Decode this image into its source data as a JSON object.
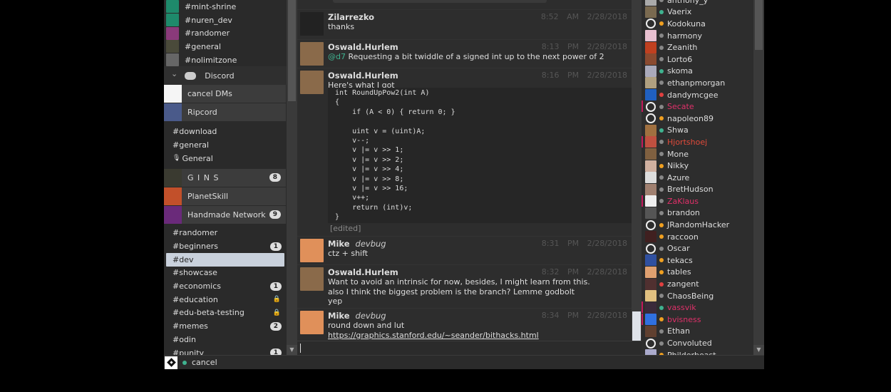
{
  "sidebar": {
    "top_channels": [
      {
        "label": "#mint-shrine",
        "color": "#1e8a6b"
      },
      {
        "label": "#nuren_dev",
        "color": "#1e8a6b"
      },
      {
        "label": "#randomer",
        "color": "#8a3a7a"
      },
      {
        "label": "#general",
        "color": "#4a4a3a"
      },
      {
        "label": "#nolimitzone",
        "color": "#666666"
      }
    ],
    "discord_header": "Discord",
    "servers_a": [
      {
        "label": "cancel DMs"
      },
      {
        "label": "Ripcord"
      }
    ],
    "ripcord_channels": [
      {
        "label": "#download"
      },
      {
        "label": "#general"
      },
      {
        "label": "General",
        "voice": true
      }
    ],
    "servers_b": [
      {
        "label": "G I N S",
        "badge": "8"
      },
      {
        "label": "PlanetSkill"
      },
      {
        "label": "Handmade Network",
        "badge": "9"
      }
    ],
    "hmn_channels": [
      {
        "label": "#randomer"
      },
      {
        "label": "#beginners",
        "badge": "1"
      },
      {
        "label": "#dev",
        "selected": true
      },
      {
        "label": "#showcase"
      },
      {
        "label": "#economics",
        "badge": "1"
      },
      {
        "label": "#education",
        "locked": true
      },
      {
        "label": "#edu-beta-testing",
        "locked": true
      },
      {
        "label": "#memes",
        "badge": "2"
      },
      {
        "label": "#odin"
      },
      {
        "label": "#punity",
        "badge": "1"
      }
    ]
  },
  "messages": [
    {
      "author": "Zilarrezko",
      "time": "8:52 AM",
      "date": "2/28/2018",
      "lines": [
        "thanks"
      ]
    },
    {
      "author": "Oswald.Hurlem",
      "time": "8:13 PM",
      "date": "2/28/2018",
      "mention": "@d7",
      "lines": [
        "Requesting a bit twiddle of a signed int up to the next power of 2"
      ]
    },
    {
      "author": "Oswald.Hurlem",
      "time": "8:16 PM",
      "date": "2/28/2018",
      "lines": [
        "Here's what I got"
      ],
      "code": " int RoundUpPow2(int A)\n {\n     if (A < 0) { return 0; }\n\n     uint v = (uint)A;\n     v--;\n     v |= v >> 1;\n     v |= v >> 2;\n     v |= v >> 4;\n     v |= v >> 8;\n     v |= v >> 16;\n     v++;\n     return (int)v;\n }",
      "edited": "[edited]"
    },
    {
      "author": "Mike",
      "role": "devbug",
      "time": "8:31 PM",
      "date": "2/28/2018",
      "lines": [
        "ctz + shift"
      ]
    },
    {
      "author": "Oswald.Hurlem",
      "time": "8:32 PM",
      "date": "2/28/2018",
      "lines": [
        "Want to avoid an intrinsic for now, besides, I might learn from this.\nalso I think the biggest problem is the branch? Lemme godbolt\nyep"
      ]
    },
    {
      "author": "Mike",
      "role": "devbug",
      "time": "8:34 PM",
      "date": "2/28/2018",
      "lines": [
        "round down and lut"
      ],
      "link": "https://graphics.stanford.edu/~seander/bithacks.html"
    }
  ],
  "input": {
    "value": ""
  },
  "members": [
    {
      "name": "anthony_y",
      "status": "#888888"
    },
    {
      "name": "Vaerix",
      "status": "#3fb28f"
    },
    {
      "name": "Kodokuna",
      "status": "#f0a020",
      "ring": true
    },
    {
      "name": "harmony",
      "status": "#888888"
    },
    {
      "name": "Zeanith",
      "status": "#888888"
    },
    {
      "name": "Lorto6",
      "status": "#888888"
    },
    {
      "name": "skoma",
      "status": "#3fb28f"
    },
    {
      "name": "ethanpmorgan",
      "status": "#888888"
    },
    {
      "name": "dandymcgee",
      "status": "#e04040"
    },
    {
      "name": "Secate",
      "status": "#888888",
      "ring": true,
      "color": "#e0306a",
      "mod": true
    },
    {
      "name": "napoleon89",
      "status": "#f0a020",
      "ring": true
    },
    {
      "name": "Shwa",
      "status": "#3fb28f"
    },
    {
      "name": "Hjortshoej",
      "status": "#888888",
      "color": "#e04a3a",
      "mod": true
    },
    {
      "name": "Mone",
      "status": "#888888"
    },
    {
      "name": "Nikky",
      "status": "#f0a020"
    },
    {
      "name": "Azure",
      "status": "#888888"
    },
    {
      "name": "BretHudson",
      "status": "#888888"
    },
    {
      "name": "ZaKlaus",
      "status": "#888888",
      "color": "#e0306a",
      "mod": true
    },
    {
      "name": "brandon",
      "status": "#888888"
    },
    {
      "name": "JRandomHacker",
      "status": "#f0a020",
      "ring": true
    },
    {
      "name": "raccoon",
      "status": "#f0a020"
    },
    {
      "name": "Oscar",
      "status": "#888888",
      "ring": true
    },
    {
      "name": "tekacs",
      "status": "#f0a020"
    },
    {
      "name": "tables",
      "status": "#f0a020"
    },
    {
      "name": "zangent",
      "status": "#e04040"
    },
    {
      "name": "ChaosBeing",
      "status": "#888888"
    },
    {
      "name": "vassvik",
      "status": "#3fb28f",
      "color": "#e0306a",
      "mod": true
    },
    {
      "name": "bvisness",
      "status": "#f0a020",
      "color": "#e0306a",
      "mod": true
    },
    {
      "name": "Ethan",
      "status": "#888888"
    },
    {
      "name": "Convoluted",
      "status": "#888888",
      "ring": true
    },
    {
      "name": "Philderbeast",
      "status": "#f0a020"
    }
  ],
  "statusbar": {
    "user": "cancel",
    "status": "#3fb28f"
  }
}
